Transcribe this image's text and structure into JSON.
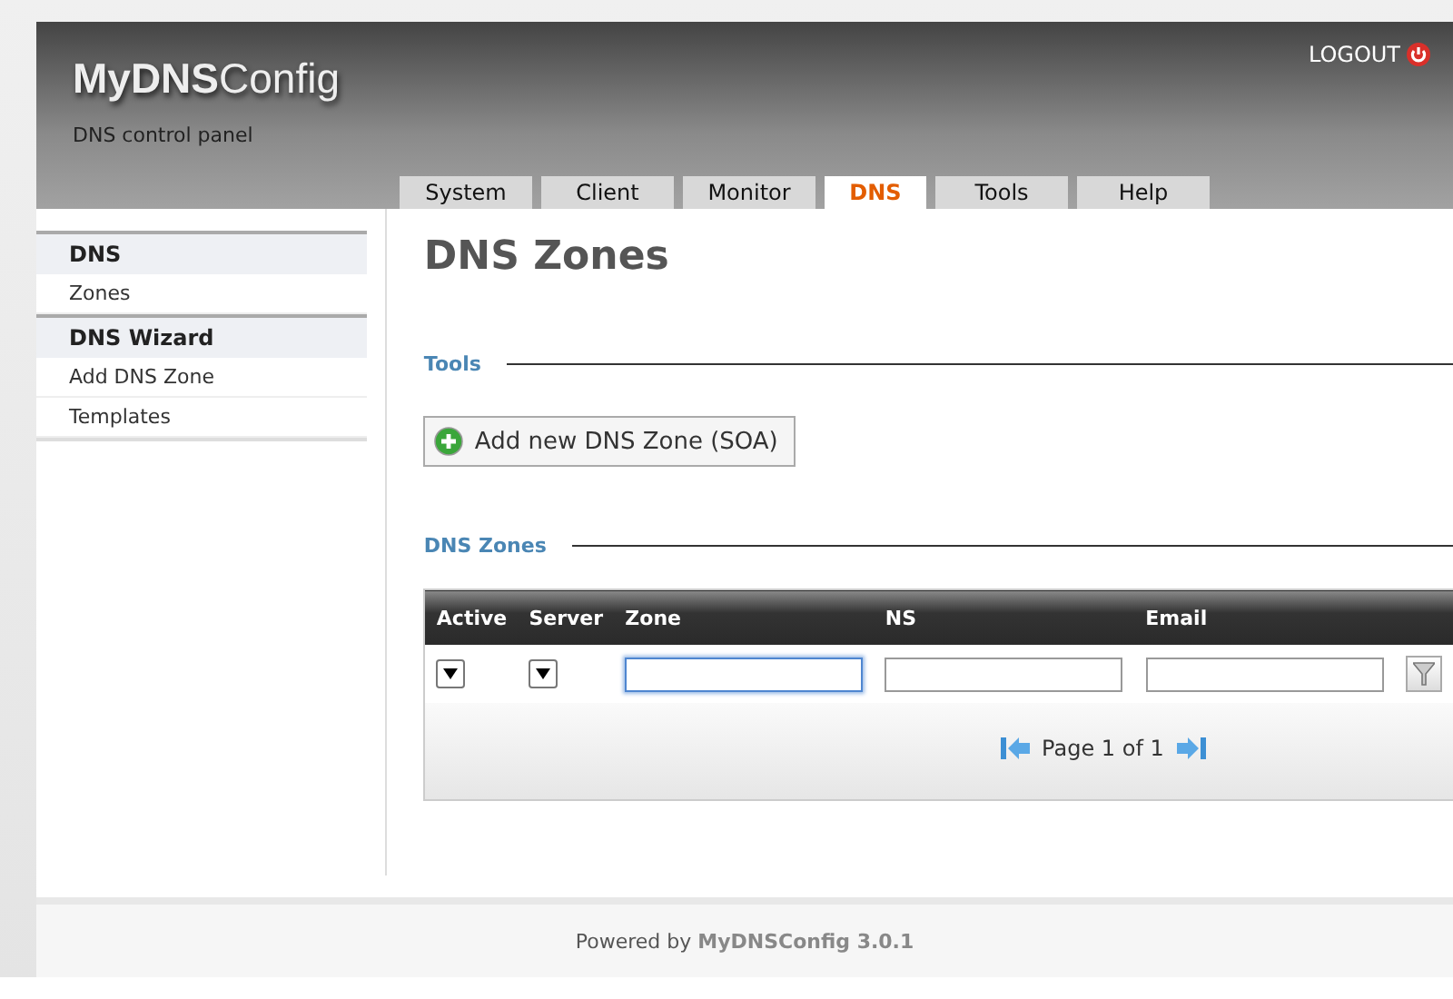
{
  "header": {
    "logo": "**MyDNS**Config",
    "subtitle": "DNS control panel",
    "logout": "LOGOUT"
  },
  "tabs": [
    {
      "label": "System",
      "selected": false
    },
    {
      "label": "Client",
      "selected": false
    },
    {
      "label": "Monitor",
      "selected": false
    },
    {
      "label": "DNS",
      "selected": true
    },
    {
      "label": "Tools",
      "selected": false
    },
    {
      "label": "Help",
      "selected": false
    }
  ],
  "sidebar": {
    "sections": [
      {
        "title": "DNS",
        "items": [
          {
            "label": "Zones"
          }
        ]
      },
      {
        "title": "DNS Wizard",
        "items": [
          {
            "label": "Add DNS Zone"
          },
          {
            "label": "Templates"
          }
        ]
      }
    ]
  },
  "page_title": "DNS Zones",
  "tools": {
    "title": "Tools",
    "button": "Add new DNS Zone (SOA)"
  },
  "zones": {
    "title": "DNS Zones",
    "columns": [
      "Active",
      "Server",
      "Zone",
      "NS",
      "Email"
    ],
    "filters": [
      {
        "kind": "select"
      },
      {
        "kind": "select"
      },
      {
        "kind": "text",
        "focused": true
      },
      {
        "kind": "text",
        "focused": false
      },
      {
        "kind": "text",
        "focused": false
      },
      {
        "kind": "filter-button"
      }
    ],
    "pager": "Page 1 of 1"
  },
  "footer": "Powered by **MyDNSConfig 3.0.1**"
}
